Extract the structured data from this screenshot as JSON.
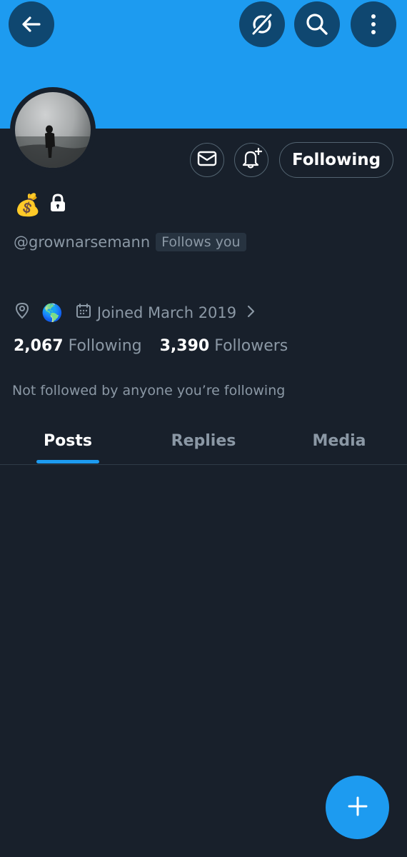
{
  "profile": {
    "name_emoji": "💰",
    "handle": "@grownarsemann",
    "follows_you_badge": "Follows you",
    "location_emoji": "🌎",
    "joined_text": "Joined March 2019",
    "following_count": "2,067",
    "following_label": "Following",
    "followers_count": "3,390",
    "followers_label": "Followers",
    "not_followed_text": "Not followed by anyone you’re following"
  },
  "actions": {
    "following_button_label": "Following"
  },
  "tabs": [
    {
      "label": "Posts",
      "active": true
    },
    {
      "label": "Replies",
      "active": false
    },
    {
      "label": "Media",
      "active": false
    }
  ],
  "icons": {
    "back": "arrow-left-icon",
    "grok": "grok-icon",
    "search": "search-icon",
    "more": "more-vertical-icon",
    "message": "envelope-icon",
    "notify": "bell-plus-icon",
    "lock": "lock-icon",
    "location": "location-pin-icon",
    "calendar": "calendar-icon",
    "chevron": "chevron-right-icon",
    "compose": "plus-icon"
  },
  "colors": {
    "accent": "#1d9bf0",
    "background": "#18202b",
    "muted_text": "#8b98a5"
  }
}
